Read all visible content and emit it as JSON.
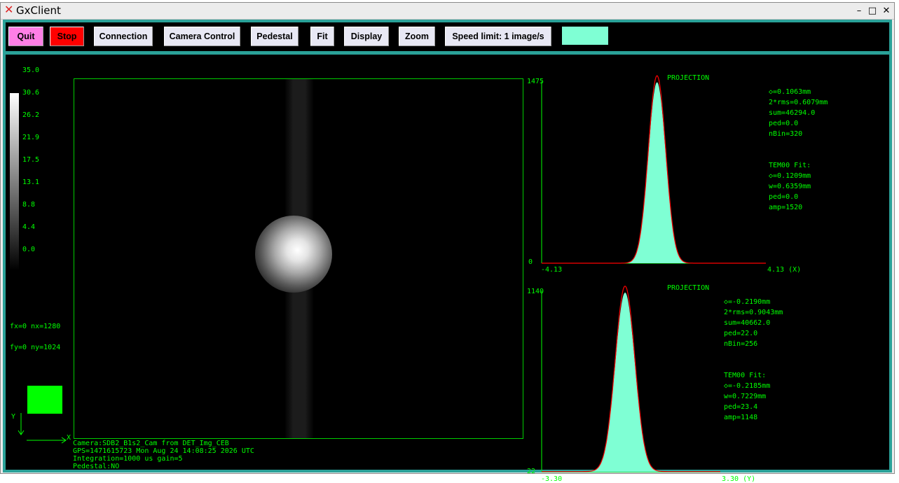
{
  "window": {
    "title": "GxClient",
    "controls": [
      "–",
      "□",
      "✕"
    ]
  },
  "toolbar": {
    "quit": "Quit",
    "stop": "Stop",
    "connection": "Connection",
    "camera_control": "Camera Control",
    "pedestal": "Pedestal",
    "fit": "Fit",
    "display": "Display",
    "zoom": "Zoom",
    "speed_limit": "Speed limit: 1 image/s",
    "swatch_color": "#7fffd4"
  },
  "colorbar": {
    "labels": [
      "35.0",
      "30.6",
      "26.2",
      "21.9",
      "17.5",
      "13.1",
      "8.8",
      "4.4",
      "0.0"
    ]
  },
  "image_info": {
    "fx": "fx=0 nx=1280",
    "fy": "fy=0 ny=1024",
    "axis_x": "X",
    "axis_y": "Y",
    "camera": "Camera:SDB2_B1s2_Cam from DET_Img_CEB",
    "gps": "GPS=1471615723 Mon Aug 24 14:08:25 2026  UTC",
    "integration": "Integration=1000 us gain=5",
    "pedestal": "Pedestal:NO"
  },
  "projection_x": {
    "title": "PROJECTION",
    "ymax": "1475",
    "ymin": "0",
    "xmin": "-4.13",
    "xmax": "4.13 (X)",
    "stats": [
      "◇=0.1063mm",
      "2*rms=0.6079mm",
      "sum=46294.0",
      "ped=0.0",
      "nBin=320"
    ],
    "fit_title": "TEM00 Fit:",
    "fit": [
      "◇=0.1209mm",
      "w=0.6359mm",
      "ped=0.0",
      "amp=1520"
    ]
  },
  "projection_y": {
    "title": "PROJECTION",
    "ymax": "1140",
    "ymin": "22",
    "xmin": "-3.30",
    "xmax": "3.30 (Y)",
    "stats": [
      "◇=-0.2190mm",
      "2*rms=0.9043mm",
      "sum=40662.0",
      "ped=22.0",
      "nBin=256"
    ],
    "fit_title": "TEM00 Fit:",
    "fit": [
      "◇=-0.2185mm",
      "w=0.7229mm",
      "ped=23.4",
      "amp=1148"
    ]
  },
  "chart_data": [
    {
      "type": "area",
      "title": "PROJECTION",
      "xlim": [
        -4.13,
        4.13
      ],
      "ylim": [
        0,
        1475
      ],
      "series": [
        {
          "values": []
        }
      ],
      "fit": {
        "center": 0.1209,
        "w": 0.6359,
        "ped": 0.0,
        "amp": 1520
      }
    },
    {
      "type": "area",
      "title": "PROJECTION",
      "xlim": [
        -3.3,
        3.3
      ],
      "ylim": [
        22,
        1140
      ],
      "series": [
        {
          "values": []
        }
      ],
      "fit": {
        "center": -0.2185,
        "w": 0.7229,
        "ped": 23.4,
        "amp": 1148
      }
    }
  ],
  "colors": {
    "accent": "#00ff00",
    "fill": "#7fffd4",
    "fit_line": "#ff0000",
    "frame": "#2aa198"
  }
}
